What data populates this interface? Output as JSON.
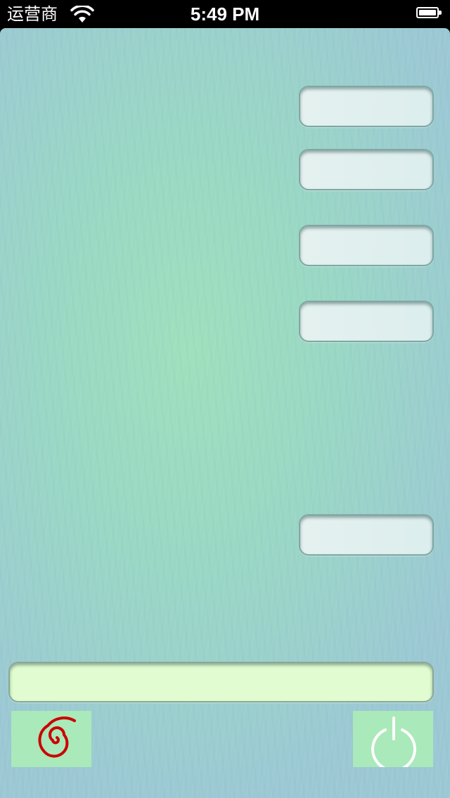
{
  "status_bar": {
    "carrier": "运营商",
    "time": "5:49 PM",
    "wifi_icon": "wifi-icon",
    "battery_icon": "battery-icon",
    "battery_level": 1.0
  },
  "form": {
    "fields": [
      {
        "value": "",
        "placeholder": ""
      },
      {
        "value": "",
        "placeholder": ""
      },
      {
        "value": "",
        "placeholder": ""
      },
      {
        "value": "",
        "placeholder": ""
      },
      {
        "value": "",
        "placeholder": ""
      }
    ],
    "bottom_field": {
      "value": "",
      "placeholder": ""
    }
  },
  "buttons": {
    "left_icon": "spiral-icon",
    "right_icon": "power-icon"
  },
  "colors": {
    "spiral": "#cc0000",
    "power": "#ffffff",
    "button_bg": "#aae9b9",
    "bottom_field_bg": "#e0fcd0"
  }
}
